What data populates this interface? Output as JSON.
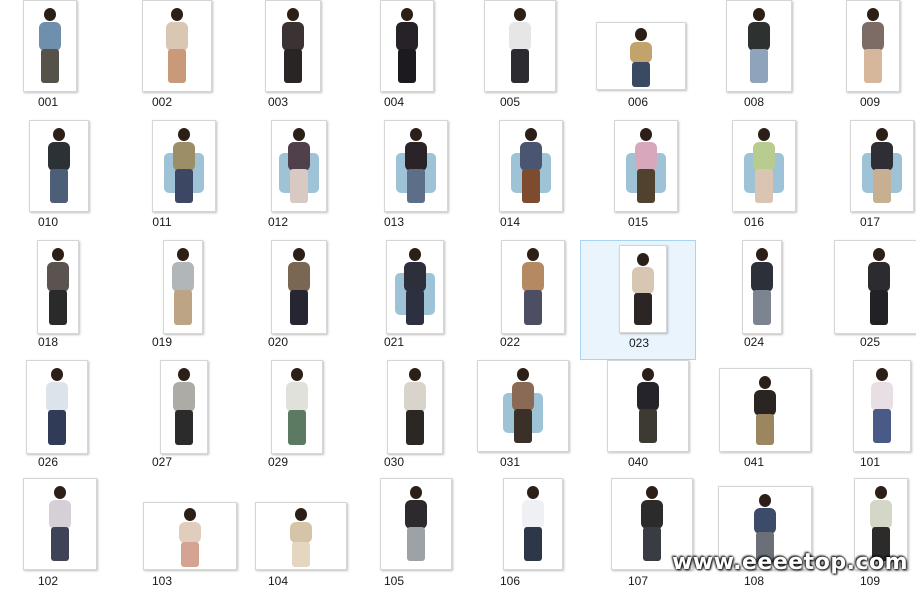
{
  "items": [
    {
      "label": "001",
      "tone": "#6f8fae",
      "legs": "#55524a",
      "chair": false
    },
    {
      "label": "002",
      "tone": "#d9c7b4",
      "legs": "#c99a7a",
      "chair": false
    },
    {
      "label": "003",
      "tone": "#3b3333",
      "legs": "#2a2424",
      "chair": false
    },
    {
      "label": "004",
      "tone": "#272228",
      "legs": "#1d1a1f",
      "chair": false
    },
    {
      "label": "005",
      "tone": "#e6e6e6",
      "legs": "#2c2c30",
      "chair": false
    },
    {
      "label": "006",
      "tone": "#c2a36c",
      "legs": "#3b4a63",
      "chair": false
    },
    {
      "label": "008",
      "tone": "#2d3230",
      "legs": "#8fa3bd",
      "chair": false
    },
    {
      "label": "009",
      "tone": "#7d6c66",
      "legs": "#d6b79b",
      "chair": false
    },
    {
      "label": "010",
      "tone": "#2c3136",
      "legs": "#4d5e78",
      "chair": false
    },
    {
      "label": "011",
      "tone": "#9c8f67",
      "legs": "#3c4863",
      "chair": true
    },
    {
      "label": "012",
      "tone": "#50404b",
      "legs": "#d8c9c2",
      "chair": true
    },
    {
      "label": "013",
      "tone": "#2a2328",
      "legs": "#5c6e88",
      "chair": true
    },
    {
      "label": "014",
      "tone": "#4a5671",
      "legs": "#7e4b2e",
      "chair": true
    },
    {
      "label": "015",
      "tone": "#d7a8bb",
      "legs": "#51412f",
      "chair": true
    },
    {
      "label": "016",
      "tone": "#b9cc8f",
      "legs": "#d9c5b2",
      "chair": true
    },
    {
      "label": "017",
      "tone": "#2e2e34",
      "legs": "#c7b092",
      "chair": true
    },
    {
      "label": "018",
      "tone": "#5a5350",
      "legs": "#2a2a2a",
      "chair": false
    },
    {
      "label": "019",
      "tone": "#b1b6b9",
      "legs": "#bca485",
      "chair": false
    },
    {
      "label": "020",
      "tone": "#7a6753",
      "legs": "#252631",
      "chair": false
    },
    {
      "label": "021",
      "tone": "#2d2f3a",
      "legs": "#2c3040",
      "chair": true
    },
    {
      "label": "022",
      "tone": "#b58a63",
      "legs": "#4b4f61",
      "chair": false
    },
    {
      "label": "023",
      "tone": "#d7c7b2",
      "legs": "#2b2524",
      "chair": false
    },
    {
      "label": "024",
      "tone": "#2c3038",
      "legs": "#7c8391",
      "chair": false
    },
    {
      "label": "025",
      "tone": "#2b2b30",
      "legs": "#222226",
      "chair": false
    },
    {
      "label": "026",
      "tone": "#dde3ea",
      "legs": "#2f3b57",
      "chair": false
    },
    {
      "label": "027",
      "tone": "#acaba6",
      "legs": "#2b2b2b",
      "chair": false
    },
    {
      "label": "029",
      "tone": "#e1e1dc",
      "legs": "#5c7a62",
      "chair": false
    },
    {
      "label": "030",
      "tone": "#d9d4cb",
      "legs": "#2b2722",
      "chair": false
    },
    {
      "label": "031",
      "tone": "#8a6a55",
      "legs": "#3b3028",
      "chair": true
    },
    {
      "label": "040",
      "tone": "#24242a",
      "legs": "#3d3a33",
      "chair": false
    },
    {
      "label": "041",
      "tone": "#2a2522",
      "legs": "#9c865f",
      "chair": false
    },
    {
      "label": "101",
      "tone": "#e8dfe4",
      "legs": "#4a5a86",
      "chair": false
    },
    {
      "label": "102",
      "tone": "#d7cfd8",
      "legs": "#3e4357",
      "chair": false
    },
    {
      "label": "103",
      "tone": "#e1cdbd",
      "legs": "#d5a391",
      "chair": false
    },
    {
      "label": "104",
      "tone": "#d6c4a8",
      "legs": "#e5d7bf",
      "chair": false
    },
    {
      "label": "105",
      "tone": "#2c2a2c",
      "legs": "#9da2a6",
      "chair": false
    },
    {
      "label": "106",
      "tone": "#eef0f3",
      "legs": "#2e3748",
      "chair": false
    },
    {
      "label": "107",
      "tone": "#2b2b2c",
      "legs": "#3a3c44",
      "chair": false
    },
    {
      "label": "108",
      "tone": "#3c4b6a",
      "legs": "#6b6f77",
      "chair": false
    },
    {
      "label": "109",
      "tone": "#d4d7c7",
      "legs": "#2d2b2a",
      "chair": false
    }
  ],
  "selected_label": "023",
  "watermark": "www.eeeetop.com"
}
